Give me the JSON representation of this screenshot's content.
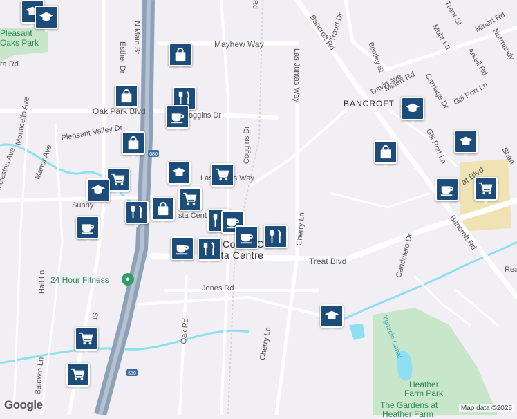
{
  "map": {
    "attribution": "Map data ©2025",
    "logo": "Google",
    "colors": {
      "background": "#f2eff4",
      "road": "#ffffff",
      "highway": "#8fa1b7",
      "water": "#8ee0f0",
      "park": "#c8e6c9",
      "school_area": "#efe3b4",
      "pin": "#1c4d7a"
    }
  },
  "labels": {
    "pleasant_hill_park": "Pleasant\nOaks Park",
    "ph_line1": "Pleasant",
    "ph_line2": "Oaks Park",
    "mayhew_way": "Mayhew Way",
    "n_main_st": "N Main St",
    "esther_dr": "Esther Dr",
    "coggins_dr_top": "Coggins Dr",
    "coggins_dr_mid": "Coggins Dr",
    "las_juntas_way_top": "Las Juntas Way",
    "las_juntas_way_mid": "Las Juntas Way",
    "bancroft_rd_top": "Bancroft Rd",
    "bancroft_rd_bottom": "Bancroft Rd",
    "bancroft_area": "BANCROFT",
    "traud_dr": "Traud Dr",
    "mohr_ln": "Mohr Ln",
    "trent_st": "Trent St",
    "minert_rd_top": "Minert Rd",
    "minert_rd_mid": "Minert Rd",
    "arkell_rd": "Arkell Rd",
    "normandy": "Normandy",
    "bentley": "Bentley St",
    "david_ave": "David Ave",
    "gill_port_ln_top": "Gill Port Ln",
    "gill_port_ln_mid": "Gill Port Ln",
    "carriage_dr": "Carriage Dr",
    "oak_park_blvd": "Oak Park Blvd",
    "pleasant_valley_dr": "Pleasant Valley Dr",
    "monticello_ave": "Monticello Ave",
    "ecclesston_ave": "Eccleston Ave",
    "manor_ave": "Manor Ave",
    "sunnyvale": "Sunny",
    "contra_costa_centre_1": "Contra Co",
    "contra_costa_centre_2": "sta Centre",
    "treat_blvd_bottom": "Treat Blvd",
    "treat_blvd_top": "at Blvd",
    "cherry_ln_top": "Cherry Ln",
    "cherry_ln_bottom": "Cherry Ln",
    "fitness": "24 Hour Fitness",
    "jones_rd": "Jones Rd",
    "oak_rd": "Oak Rd",
    "hall_ln": "Hall Ln",
    "baldwin_ln": "Baldwin Ln",
    "st_label": "St",
    "candelero_dr": "Candelero Dr",
    "ygnacio_canal": "Ygnacio Canal",
    "heather_farm_park_1": "Heather",
    "heather_farm_park_2": "Farm Park",
    "gardens_heather_farm": "The Gardens at",
    "gardens_heather_farm_2": "Heather Farm",
    "reada": "Read",
    "shan": "Shan",
    "highway_shield": "680",
    "ra_rd": "ra Rd",
    "rd_label": "Rd",
    "las_label": "Las",
    "sta_cent": "sta Cent"
  },
  "pins": [
    {
      "type": "school",
      "icon": "graduation-cap-icon"
    },
    {
      "type": "school",
      "icon": "graduation-cap-icon"
    },
    {
      "type": "shopping",
      "icon": "shopping-bag-icon"
    },
    {
      "type": "shopping",
      "icon": "shopping-bag-icon"
    },
    {
      "type": "restaurant",
      "icon": "fork-knife-icon"
    },
    {
      "type": "cafe",
      "icon": "coffee-cup-icon"
    },
    {
      "type": "shopping",
      "icon": "shopping-bag-icon"
    },
    {
      "type": "school",
      "icon": "graduation-cap-icon"
    },
    {
      "type": "grocery",
      "icon": "shopping-cart-icon"
    },
    {
      "type": "grocery",
      "icon": "shopping-cart-icon"
    },
    {
      "type": "school",
      "icon": "graduation-cap-icon"
    },
    {
      "type": "grocery",
      "icon": "shopping-cart-icon"
    },
    {
      "type": "restaurant",
      "icon": "fork-knife-icon"
    },
    {
      "type": "shopping",
      "icon": "shopping-bag-icon"
    },
    {
      "type": "cafe",
      "icon": "coffee-cup-icon"
    },
    {
      "type": "restaurant",
      "icon": "fork-knife-icon"
    },
    {
      "type": "cafe",
      "icon": "coffee-cup-icon"
    },
    {
      "type": "restaurant",
      "icon": "fork-knife-icon"
    },
    {
      "type": "cafe",
      "icon": "coffee-cup-icon"
    },
    {
      "type": "restaurant",
      "icon": "fork-knife-icon"
    },
    {
      "type": "school",
      "icon": "graduation-cap-icon"
    },
    {
      "type": "shopping",
      "icon": "shopping-bag-icon"
    },
    {
      "type": "school",
      "icon": "graduation-cap-icon"
    },
    {
      "type": "cafe",
      "icon": "coffee-cup-icon"
    },
    {
      "type": "grocery",
      "icon": "shopping-cart-icon"
    },
    {
      "type": "school",
      "icon": "graduation-cap-icon"
    },
    {
      "type": "grocery",
      "icon": "shopping-cart-icon"
    },
    {
      "type": "grocery",
      "icon": "shopping-cart-icon"
    },
    {
      "type": "cafe",
      "icon": "coffee-cup-icon"
    }
  ]
}
